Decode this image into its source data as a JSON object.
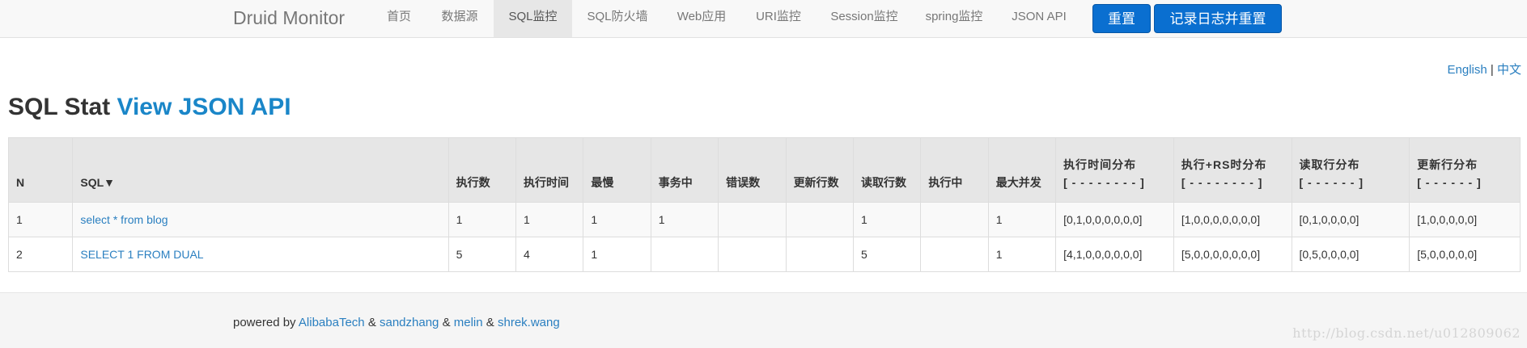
{
  "navbar": {
    "brand": "Druid Monitor",
    "items": [
      {
        "label": "首页",
        "active": false
      },
      {
        "label": "数据源",
        "active": false
      },
      {
        "label": "SQL监控",
        "active": true
      },
      {
        "label": "SQL防火墙",
        "active": false
      },
      {
        "label": "Web应用",
        "active": false
      },
      {
        "label": "URI监控",
        "active": false
      },
      {
        "label": "Session监控",
        "active": false
      },
      {
        "label": "spring监控",
        "active": false
      },
      {
        "label": "JSON API",
        "active": false
      }
    ],
    "reset_label": "重置",
    "log_reset_label": "记录日志并重置"
  },
  "lang": {
    "english": "English",
    "separator": "|",
    "chinese": "中文"
  },
  "title": {
    "text": "SQL Stat",
    "link": "View JSON API"
  },
  "table": {
    "headers": {
      "n": "N",
      "sql": "SQL▼",
      "exec_count": "执行数",
      "exec_time": "执行时间",
      "slowest": "最慢",
      "in_txn": "事务中",
      "errors": "错误数",
      "update_rows": "更新行数",
      "fetch_rows": "读取行数",
      "running": "执行中",
      "max_concurrent": "最大并发",
      "exec_hist": "执行时间分布",
      "exec_hist_sub": "[ - - - - - - - - ]",
      "exec_rs_hist": "执行+RS时分布",
      "exec_rs_hist_sub": "[ - - - - - - - - ]",
      "fetch_hist": "读取行分布",
      "fetch_hist_sub": "[ - - - - - - ]",
      "update_hist": "更新行分布",
      "update_hist_sub": "[ - - - - - - ]"
    },
    "rows": [
      {
        "n": "1",
        "sql": "select * from blog",
        "exec_count": "1",
        "exec_time": "1",
        "slowest": "1",
        "in_txn": "1",
        "errors": "",
        "update_rows": "",
        "fetch_rows": "1",
        "running": "",
        "max_concurrent": "1",
        "exec_hist": "[0,1,0,0,0,0,0,0]",
        "exec_rs_hist": "[1,0,0,0,0,0,0,0]",
        "fetch_hist": "[0,1,0,0,0,0]",
        "update_hist": "[1,0,0,0,0,0]"
      },
      {
        "n": "2",
        "sql": "SELECT 1 FROM DUAL",
        "exec_count": "5",
        "exec_time": "4",
        "slowest": "1",
        "in_txn": "",
        "errors": "",
        "update_rows": "",
        "fetch_rows": "5",
        "running": "",
        "max_concurrent": "1",
        "exec_hist": "[4,1,0,0,0,0,0,0]",
        "exec_rs_hist": "[5,0,0,0,0,0,0,0]",
        "fetch_hist": "[0,5,0,0,0,0]",
        "update_hist": "[5,0,0,0,0,0]"
      }
    ]
  },
  "footer": {
    "powered_by": "powered by",
    "author1": "AlibabaTech",
    "amp1": "&",
    "author2": "sandzhang",
    "amp2": "&",
    "author3": "melin",
    "amp3": "&",
    "author4": "shrek.wang",
    "watermark": "http://blog.csdn.net/u012809062"
  },
  "colors": {
    "accent_button": "#0a6fd0",
    "link": "#2a7fc0",
    "title_link": "#1a86c8",
    "header_bg": "#e6e6e6",
    "nav_bg": "#f8f8f8",
    "footer_bg": "#f5f5f5"
  }
}
